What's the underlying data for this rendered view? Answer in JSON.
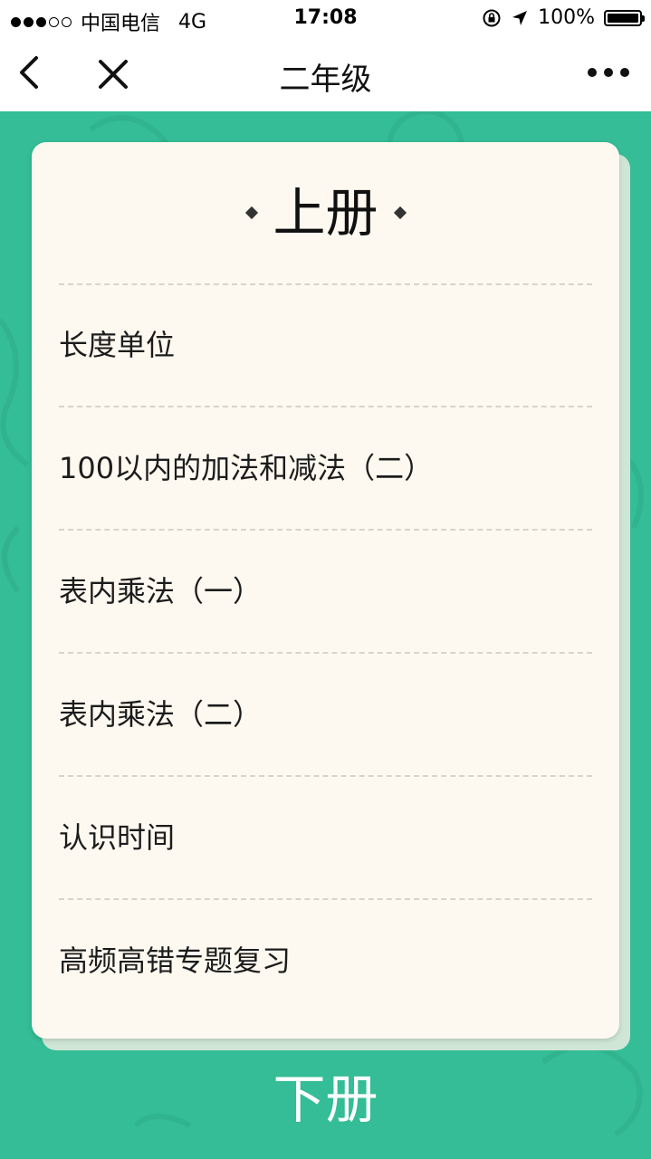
{
  "status_bar": {
    "carrier": "中国电信",
    "network": "4G",
    "time": "17:08",
    "battery": "100%"
  },
  "nav": {
    "title": "二年级",
    "back_icon": "chevron-left-icon",
    "close_icon": "close-icon",
    "more_icon": "more-dots-icon"
  },
  "card": {
    "title": "上册",
    "items": [
      "长度单位",
      "100以内的加法和减法（二）",
      "表内乘法（一）",
      "表内乘法（二）",
      "认识时间",
      "高频高错专题复习"
    ]
  },
  "bottom": {
    "label": "下册"
  },
  "colors": {
    "background": "#34bd96",
    "card": "#fdf9f0",
    "text": "#1c1c1c"
  }
}
